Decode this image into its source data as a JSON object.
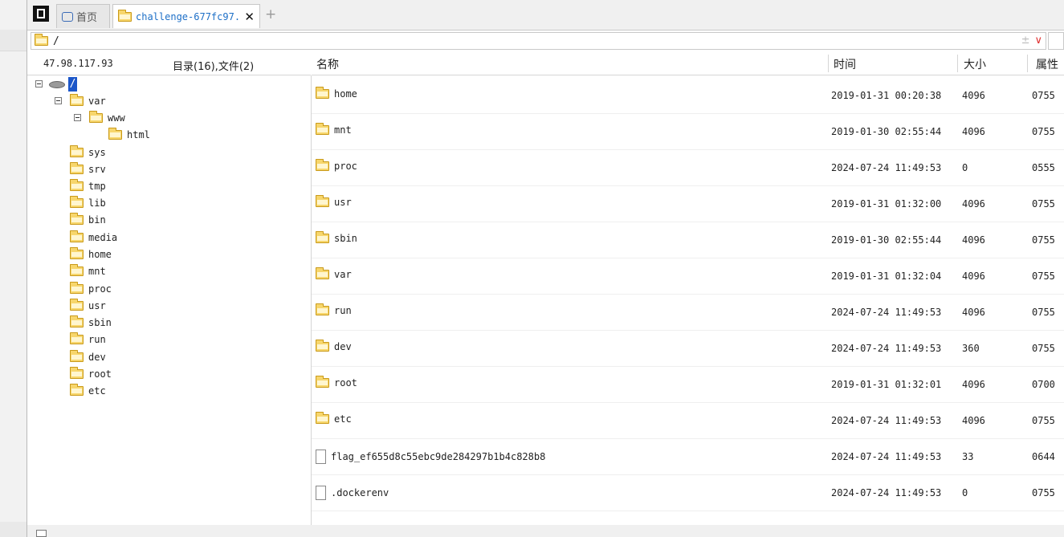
{
  "tabs": {
    "home_label": "首页",
    "active_label": "challenge-677fc97.",
    "close_glyph": "✕",
    "add_glyph": "+"
  },
  "address": {
    "path": "/",
    "controls": "±",
    "dropdown": "∨"
  },
  "tree": {
    "host": "47.98.117.93",
    "summary": "目录(16),文件(2)",
    "root_label": "/",
    "nodes": [
      "var",
      "www",
      "html",
      "sys",
      "srv",
      "tmp",
      "lib",
      "bin",
      "media",
      "home",
      "mnt",
      "proc",
      "usr",
      "sbin",
      "run",
      "dev",
      "root",
      "etc"
    ]
  },
  "list": {
    "columns": {
      "name": "名称",
      "time": "时间",
      "size": "大小",
      "perm": "属性"
    },
    "rows": [
      {
        "name": "home",
        "time": "2019-01-31 00:20:38",
        "size": "4096",
        "perm": "0755",
        "kind": "folder"
      },
      {
        "name": "mnt",
        "time": "2019-01-30 02:55:44",
        "size": "4096",
        "perm": "0755",
        "kind": "folder"
      },
      {
        "name": "proc",
        "time": "2024-07-24 11:49:53",
        "size": "0",
        "perm": "0555",
        "kind": "folder"
      },
      {
        "name": "usr",
        "time": "2019-01-31 01:32:00",
        "size": "4096",
        "perm": "0755",
        "kind": "folder"
      },
      {
        "name": "sbin",
        "time": "2019-01-30 02:55:44",
        "size": "4096",
        "perm": "0755",
        "kind": "folder"
      },
      {
        "name": "var",
        "time": "2019-01-31 01:32:04",
        "size": "4096",
        "perm": "0755",
        "kind": "folder"
      },
      {
        "name": "run",
        "time": "2024-07-24 11:49:53",
        "size": "4096",
        "perm": "0755",
        "kind": "folder"
      },
      {
        "name": "dev",
        "time": "2024-07-24 11:49:53",
        "size": "360",
        "perm": "0755",
        "kind": "folder"
      },
      {
        "name": "root",
        "time": "2019-01-31 01:32:01",
        "size": "4096",
        "perm": "0700",
        "kind": "folder"
      },
      {
        "name": "etc",
        "time": "2024-07-24 11:49:53",
        "size": "4096",
        "perm": "0755",
        "kind": "folder"
      },
      {
        "name": "flag_ef655d8c55ebc9de284297b1b4c828b8",
        "time": "2024-07-24 11:49:53",
        "size": "33",
        "perm": "0644",
        "kind": "file"
      },
      {
        "name": ".dockerenv",
        "time": "2024-07-24 11:49:53",
        "size": "0",
        "perm": "0755",
        "kind": "file"
      }
    ]
  }
}
